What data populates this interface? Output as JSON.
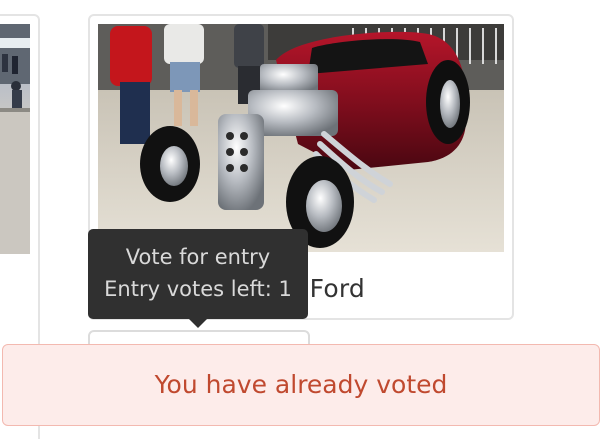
{
  "entries": [
    {
      "title": "1934 Ford",
      "photo": "red-1934-ford-hot-rod-at-car-show"
    }
  ],
  "tooltip": {
    "line1": "Vote for entry",
    "line2": "Entry votes left: 1"
  },
  "alert": {
    "message": "You have already voted",
    "color": "#c0492f",
    "background": "#fdecea"
  }
}
